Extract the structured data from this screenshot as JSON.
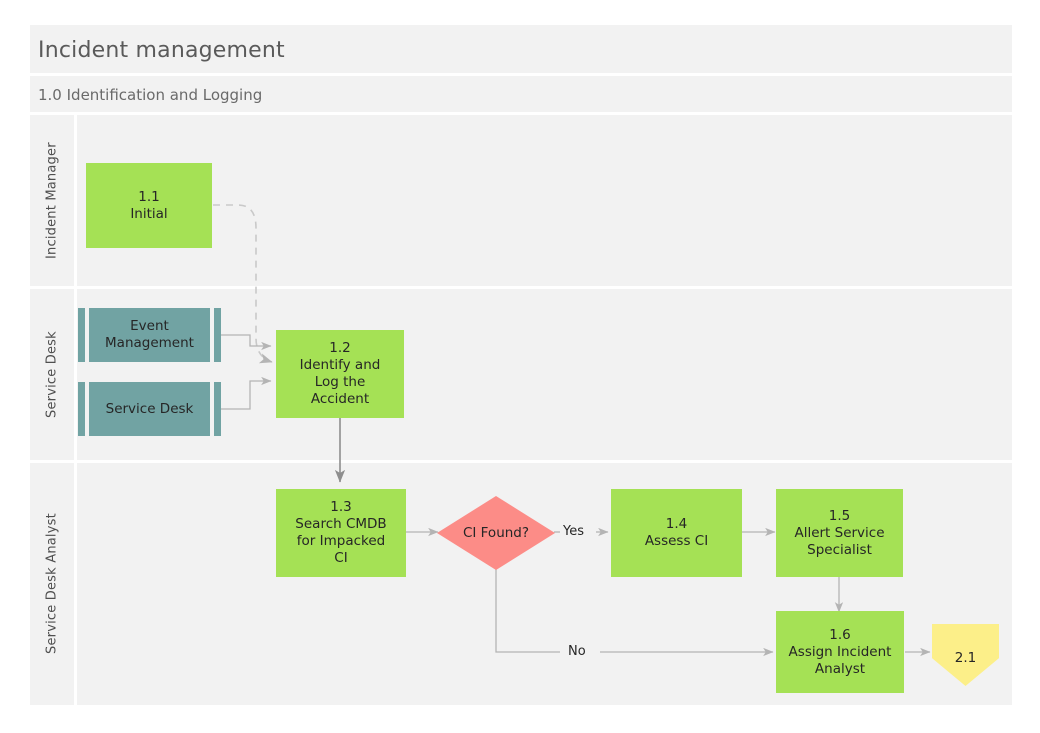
{
  "diagram": {
    "title": "Incident management",
    "phase": "1.0 Identification and Logging"
  },
  "lanes": [
    {
      "id": "incident-manager",
      "label": "Incident Manager"
    },
    {
      "id": "service-desk",
      "label": "Service Desk"
    },
    {
      "id": "service-desk-analyst",
      "label": "Service Desk Analyst"
    }
  ],
  "nodes": {
    "n11": {
      "num": "1.1",
      "name": "Initial",
      "type": "process",
      "lane": "Incident Manager"
    },
    "event_management": {
      "num": "",
      "name": "Event Management",
      "type": "subprocess",
      "lane": "Service Desk"
    },
    "service_desk": {
      "num": "",
      "name": "Service Desk",
      "type": "subprocess",
      "lane": "Service Desk"
    },
    "n12": {
      "num": "1.2",
      "name_lines": [
        "Identify and",
        "Log the",
        "Accident"
      ],
      "type": "process",
      "lane": "Service Desk"
    },
    "n13": {
      "num": "1.3",
      "name_lines": [
        "Search CMDB",
        "for Impacked",
        "CI"
      ],
      "type": "process",
      "lane": "Service Desk Analyst"
    },
    "decision": {
      "num": "",
      "name": "CI Found?",
      "type": "decision",
      "lane": "Service Desk Analyst"
    },
    "n14": {
      "num": "1.4",
      "name_lines": [
        "Assess CI"
      ],
      "type": "process",
      "lane": "Service Desk Analyst"
    },
    "n15": {
      "num": "1.5",
      "name_lines": [
        "Allert Service",
        "Specialist"
      ],
      "type": "process",
      "lane": "Service Desk Analyst"
    },
    "n16": {
      "num": "1.6",
      "name_lines": [
        "Assign Incident",
        "Analyst"
      ],
      "type": "process",
      "lane": "Service Desk Analyst"
    },
    "n21": {
      "num": "2.1",
      "name": "",
      "type": "offpage",
      "lane": "Service Desk Analyst"
    }
  },
  "node_text": {
    "n11_num": "1.1",
    "n11_name": "Initial",
    "event_management_name1": "Event",
    "event_management_name2": "Management",
    "service_desk_name": "Service Desk",
    "n12_num": "1.2",
    "n12_l1": "Identify and",
    "n12_l2": "Log the",
    "n12_l3": "Accident",
    "n13_num": "1.3",
    "n13_l1": "Search CMDB",
    "n13_l2": "for Impacked",
    "n13_l3": "CI",
    "decision_label": "CI Found?",
    "n14_num": "1.4",
    "n14_l1": "Assess CI",
    "n15_num": "1.5",
    "n15_l1": "Allert Service",
    "n15_l2": "Specialist",
    "n16_num": "1.6",
    "n16_l1": "Assign Incident",
    "n16_l2": "Analyst",
    "n21_num": "2.1"
  },
  "edges": {
    "yes_label": "Yes",
    "no_label": "No"
  },
  "colors": {
    "canvas": "#ffffff",
    "lane_bg": "#f2f2f2",
    "lane_divider": "#ffffff",
    "process_green": "#a5e155",
    "subprocess_teal": "#71a3a3",
    "decision_salmon": "#fc8c87",
    "offpage_yellow": "#fcef89",
    "connector_gray": "#a8a8a8",
    "title_text": "#5a5a5a",
    "body_text": "#262626"
  }
}
